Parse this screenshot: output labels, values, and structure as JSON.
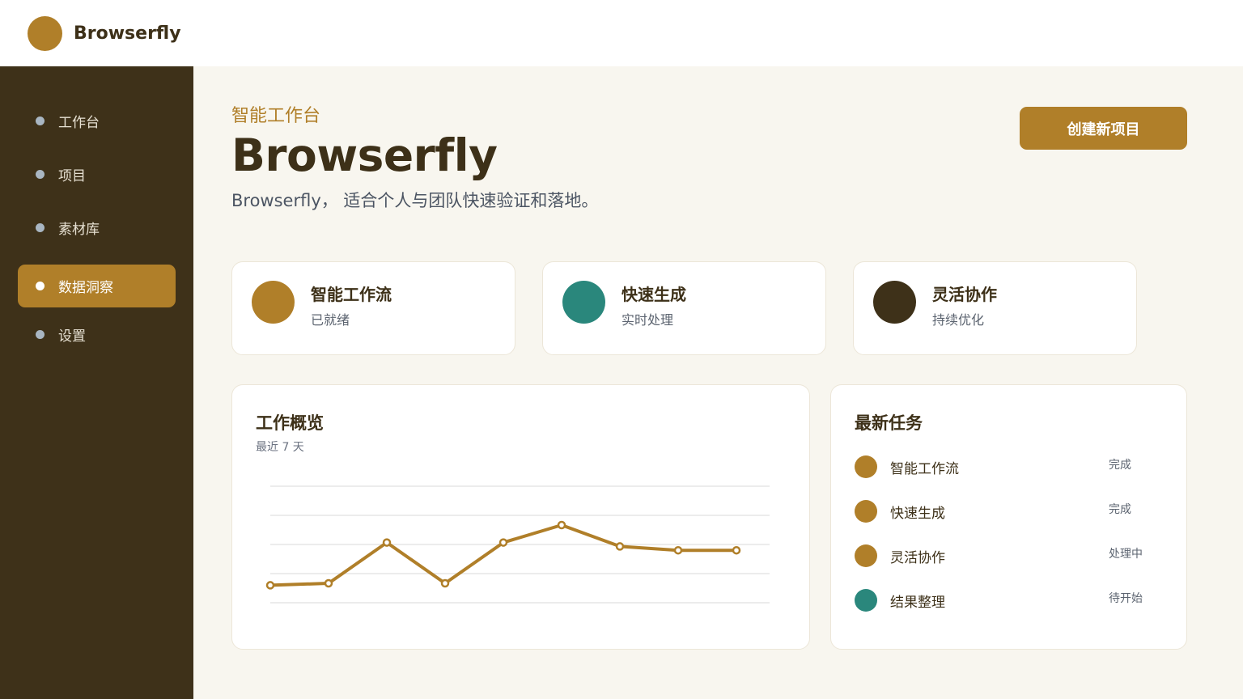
{
  "app": {
    "name": "Browserfly"
  },
  "sidebar": {
    "items": [
      {
        "label": "工作台",
        "active": false
      },
      {
        "label": "项目",
        "active": false
      },
      {
        "label": "素材库",
        "active": false
      },
      {
        "label": "数据洞察",
        "active": true
      },
      {
        "label": "设置",
        "active": false
      }
    ]
  },
  "hero": {
    "eyebrow": "智能工作台",
    "title": "Browserfly",
    "subtitle": "Browserfly， 适合个人与团队快速验证和落地。",
    "cta_label": "创建新项目"
  },
  "stats": [
    {
      "title": "智能工作流",
      "sub": "已就绪",
      "color": "#b07f29"
    },
    {
      "title": "快速生成",
      "sub": "实时处理",
      "color": "#2a877c"
    },
    {
      "title": "灵活协作",
      "sub": "持续优化",
      "color": "#3e3119"
    }
  ],
  "overview": {
    "title": "工作概览",
    "subtitle": "最近 7 天"
  },
  "chart_data": {
    "type": "line",
    "x": [
      1,
      2,
      3,
      4,
      5,
      6,
      7,
      8,
      9
    ],
    "series": [
      {
        "values": [
          9,
          10,
          31,
          10,
          31,
          40,
          29,
          27,
          27
        ],
        "color": "#b07f29"
      }
    ],
    "ylim": [
      0,
      60
    ],
    "grid": true,
    "gridlines": 5
  },
  "tasks": {
    "title": "最新任务",
    "items": [
      {
        "name": "智能工作流",
        "status": "完成",
        "color": "#b07f29"
      },
      {
        "name": "快速生成",
        "status": "完成",
        "color": "#b07f29"
      },
      {
        "name": "灵活协作",
        "status": "处理中",
        "color": "#b07f29"
      },
      {
        "name": "结果整理",
        "status": "待开始",
        "color": "#2a877c"
      }
    ]
  },
  "colors": {
    "accent": "#b07f29",
    "teal": "#2a877c",
    "dark": "#3e3119"
  }
}
